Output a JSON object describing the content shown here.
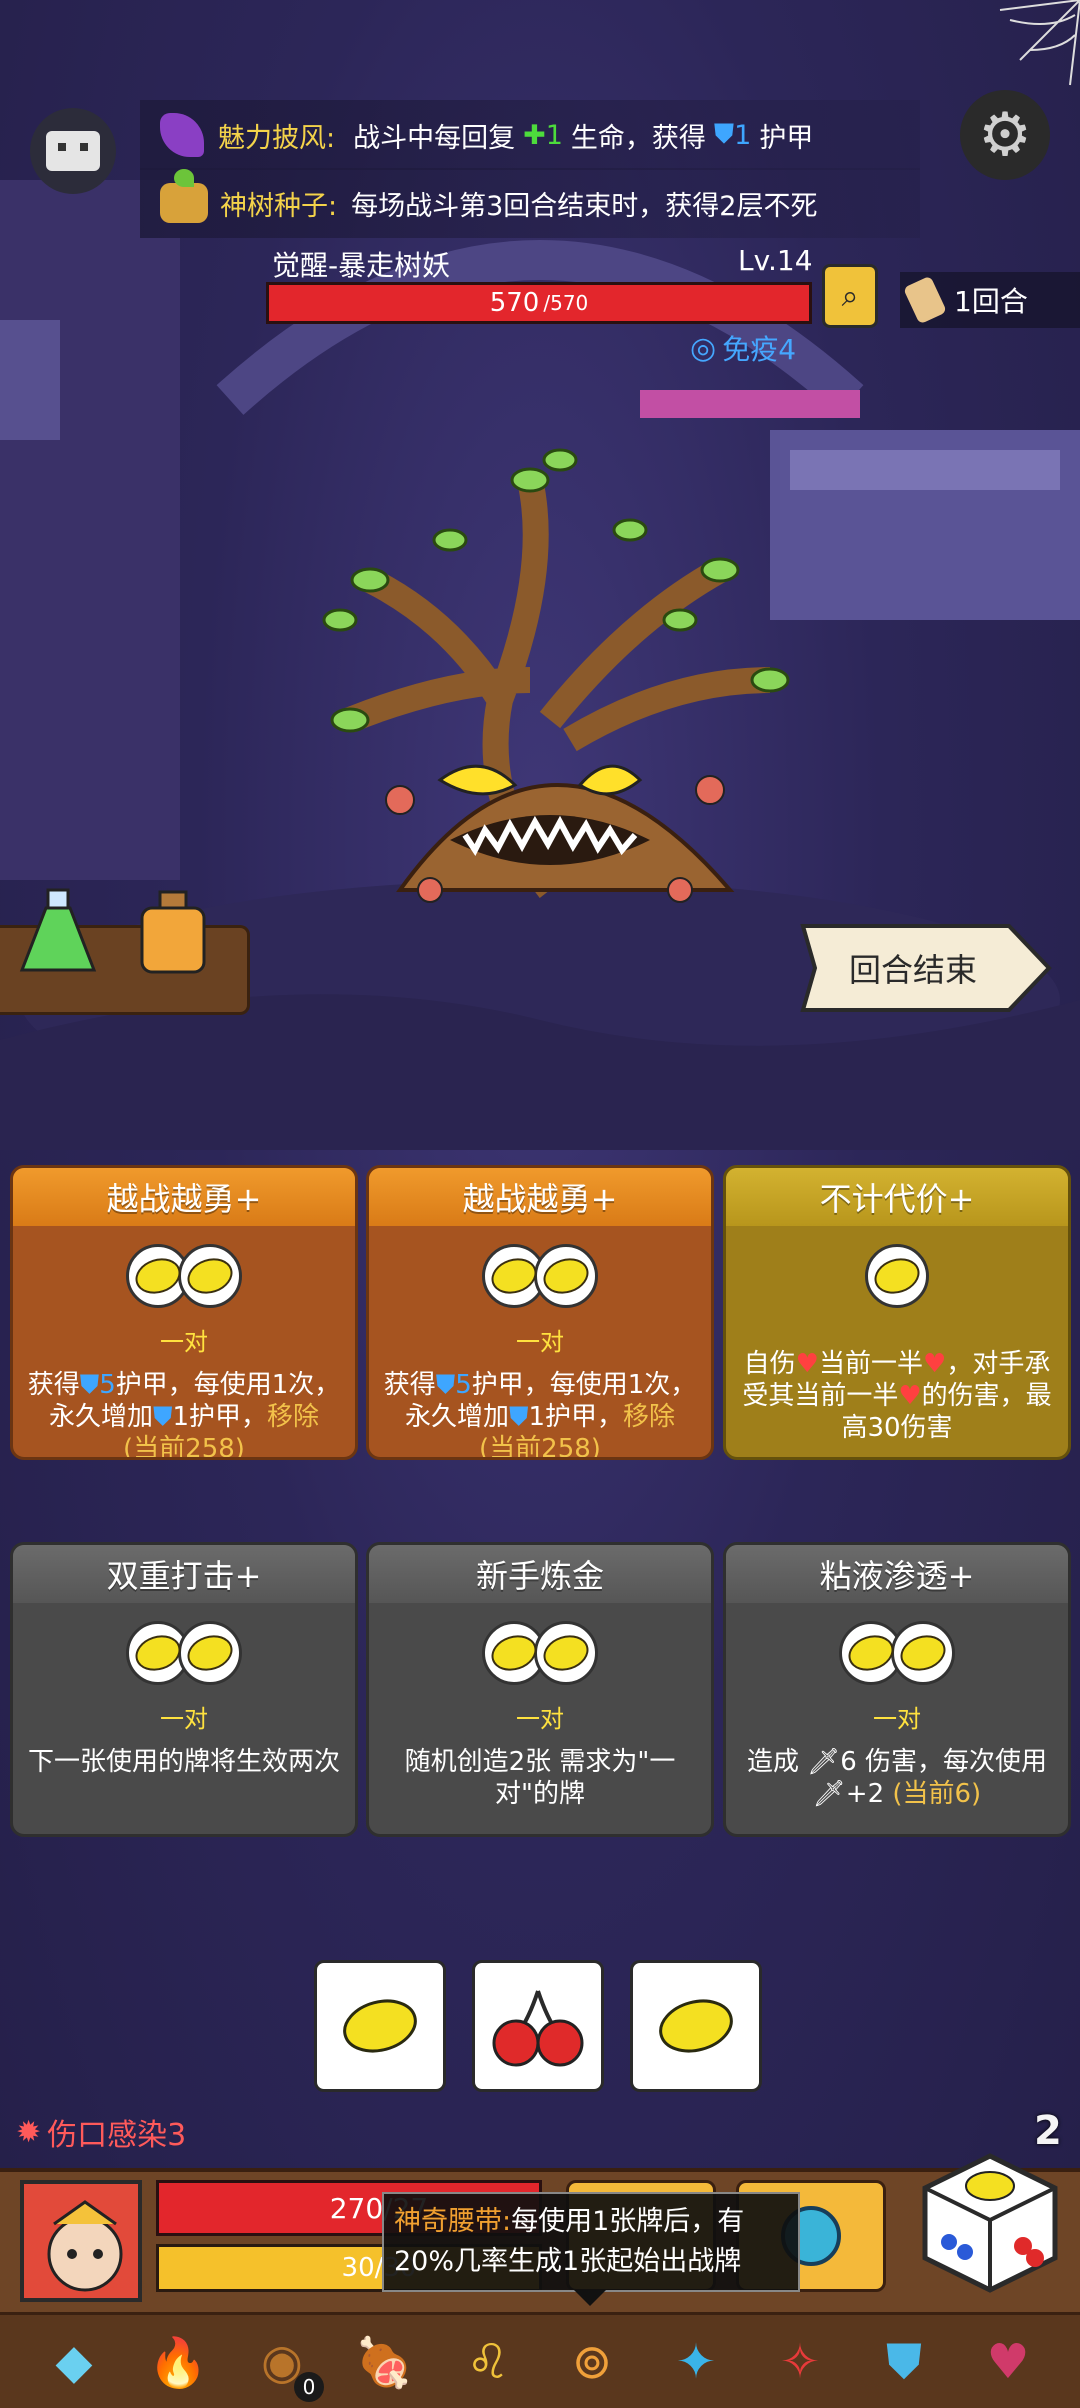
{
  "top_buffs": [
    {
      "icon": "cape-icon",
      "title": "魅力披风:",
      "text": "战斗中每回复",
      "heal": "1",
      "mid": "生命，获得",
      "armor": "1",
      "tail": "护甲"
    },
    {
      "icon": "seed-icon",
      "title": "神树种子:",
      "text": "每场战斗第3回合结束时，获得2层不死"
    }
  ],
  "enemy": {
    "name": "觉醒-暴走树妖",
    "level": "Lv.14",
    "hp": "570",
    "hp_max": "/570",
    "hp_fraction": 1.0,
    "status": "免疫4"
  },
  "round": "1回合",
  "end_turn_label": "回合结束",
  "cards": [
    {
      "title": "越战越勇+",
      "req": "一对",
      "desc_a": "获得",
      "desc_armor": "5",
      "desc_b": "护甲，每使用1次，永久增加",
      "desc_armor2": "1",
      "desc_c": "护甲，",
      "desc_d": "移除",
      "desc_e": "(当前258)"
    },
    {
      "title": "越战越勇+",
      "req": "一对",
      "desc_a": "获得",
      "desc_armor": "5",
      "desc_b": "护甲，每使用1次，永久增加",
      "desc_armor2": "1",
      "desc_c": "护甲，",
      "desc_d": "移除",
      "desc_e": "(当前258)"
    },
    {
      "title": "不计代价+",
      "desc_a": "自伤",
      "desc_b": "当前一半",
      "desc_c": "，对手承受其当前一半",
      "desc_d": "的伤害，最高30伤害"
    },
    {
      "title": "双重打击+",
      "req": "一对",
      "desc": "下一张使用的牌将生效两次"
    },
    {
      "title": "新手炼金",
      "req": "一对",
      "desc": "随机创造2张 需求为\"一对\"的牌"
    },
    {
      "title": "粘液渗透+",
      "req": "一对",
      "desc_a": "造成",
      "desc_b": "6 伤害，每次使用",
      "desc_c": "+2",
      "desc_d": "(当前6)"
    }
  ],
  "dice_faces": [
    "lemon",
    "cherry",
    "lemon"
  ],
  "player": {
    "status": "伤口感染3",
    "hp": "270/27",
    "armor": "30/30"
  },
  "dice_count": "2",
  "tooltip": {
    "title": "神奇腰带:",
    "text": "每使用1张牌后，有20%几率生成1张起始出战牌"
  },
  "relic_badge": "0",
  "colors": {
    "hp_red": "#e3262c",
    "armor_yellow": "#f5c12b",
    "card_orange": "#d97b17",
    "card_yellow": "#b8961c",
    "card_gray": "#565656"
  }
}
